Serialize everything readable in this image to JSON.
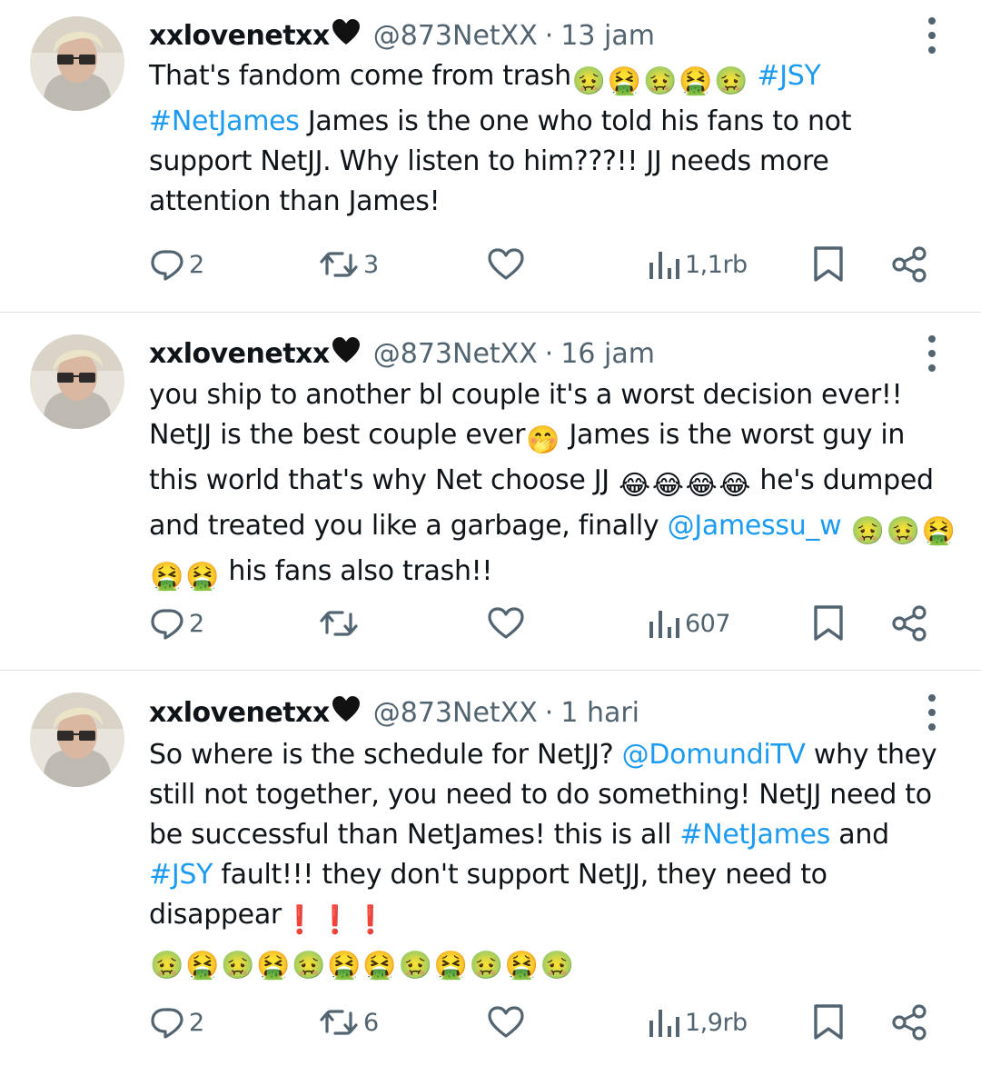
{
  "tweets": [
    {
      "name": "xxlovenetxx",
      "name_emoji": "🖤",
      "handle": "@873NetXX",
      "separator": "·",
      "time": "13 jam",
      "body": [
        {
          "t": "text",
          "v": "That's fandom come from trash"
        },
        {
          "t": "emoji",
          "v": "🤢"
        },
        {
          "t": "emoji",
          "v": "🤮"
        },
        {
          "t": "emoji",
          "v": "🤢"
        },
        {
          "t": "emoji",
          "v": "🤮"
        },
        {
          "t": "emoji",
          "v": "🤢"
        },
        {
          "t": "text",
          "v": " "
        },
        {
          "t": "link",
          "v": "#JSY"
        },
        {
          "t": "br"
        },
        {
          "t": "link",
          "v": "#NetJames"
        },
        {
          "t": "text",
          "v": " James is the one who told his fans to not"
        },
        {
          "t": "br"
        },
        {
          "t": "text",
          "v": "support NetJJ. Why listen to him???!! JJ needs more"
        },
        {
          "t": "br"
        },
        {
          "t": "text",
          "v": "attention than James!"
        }
      ],
      "replies": "2",
      "retweets": "3",
      "likes": "",
      "views": "1,1rb"
    },
    {
      "name": "xxlovenetxx",
      "name_emoji": "🖤",
      "handle": "@873NetXX",
      "separator": "·",
      "time": "16 jam",
      "body": [
        {
          "t": "text",
          "v": "you ship to another bl couple it's a worst decision ever!!"
        },
        {
          "t": "br"
        },
        {
          "t": "text",
          "v": "NetJJ is the best couple ever"
        },
        {
          "t": "emoji",
          "v": "🤭"
        },
        {
          "t": "text",
          "v": " James is the worst guy in"
        },
        {
          "t": "br"
        },
        {
          "t": "text",
          "v": "this world that's why Net choose JJ "
        },
        {
          "t": "emoji",
          "v": "😂"
        },
        {
          "t": "emoji",
          "v": "😂"
        },
        {
          "t": "emoji",
          "v": "😂"
        },
        {
          "t": "emoji",
          "v": "😂"
        },
        {
          "t": "text",
          "v": " he's dumped"
        },
        {
          "t": "br"
        },
        {
          "t": "text",
          "v": "and treated you like a garbage, finally "
        },
        {
          "t": "link",
          "v": "@Jamessu_w"
        },
        {
          "t": "text",
          "v": " "
        },
        {
          "t": "emoji",
          "v": "🤢"
        },
        {
          "t": "emoji",
          "v": "🤢"
        },
        {
          "t": "emoji",
          "v": "🤮"
        },
        {
          "t": "br"
        },
        {
          "t": "emoji",
          "v": "🤮"
        },
        {
          "t": "emoji",
          "v": "🤮"
        },
        {
          "t": "text",
          "v": " his fans also trash!!"
        }
      ],
      "replies": "2",
      "retweets": "",
      "likes": "",
      "views": "607"
    },
    {
      "name": "xxlovenetxx",
      "name_emoji": "🖤",
      "handle": "@873NetXX",
      "separator": "·",
      "time": "1 hari",
      "body": [
        {
          "t": "text",
          "v": "So where is the schedule for NetJJ? "
        },
        {
          "t": "link",
          "v": "@DomundiTV"
        },
        {
          "t": "text",
          "v": " why they"
        },
        {
          "t": "br"
        },
        {
          "t": "text",
          "v": "still not together, you need to do something! NetJJ need to"
        },
        {
          "t": "br"
        },
        {
          "t": "text",
          "v": "be successful than NetJames! this is all "
        },
        {
          "t": "link",
          "v": "#NetJames"
        },
        {
          "t": "text",
          "v": " and"
        },
        {
          "t": "br"
        },
        {
          "t": "link",
          "v": "#JSY"
        },
        {
          "t": "text",
          "v": " fault!!! they don't support NetJJ, they need to"
        },
        {
          "t": "br"
        },
        {
          "t": "text",
          "v": "disappear"
        },
        {
          "t": "emoji",
          "v": "❗"
        },
        {
          "t": "emoji",
          "v": "❗"
        },
        {
          "t": "emoji",
          "v": "❗"
        },
        {
          "t": "br"
        },
        {
          "t": "emoji",
          "v": "🤢"
        },
        {
          "t": "emoji",
          "v": "🤮"
        },
        {
          "t": "emoji",
          "v": "🤢"
        },
        {
          "t": "emoji",
          "v": "🤮"
        },
        {
          "t": "emoji",
          "v": "🤢"
        },
        {
          "t": "emoji",
          "v": "🤮"
        },
        {
          "t": "emoji",
          "v": "🤮"
        },
        {
          "t": "emoji",
          "v": "🤢"
        },
        {
          "t": "emoji",
          "v": "🤮"
        },
        {
          "t": "emoji",
          "v": "🤢"
        },
        {
          "t": "emoji",
          "v": "🤮"
        },
        {
          "t": "emoji",
          "v": "🤢"
        }
      ],
      "replies": "2",
      "retweets": "6",
      "likes": "",
      "views": "1,9rb"
    }
  ],
  "icons": {
    "reply": "reply-icon",
    "retweet": "retweet-icon",
    "like": "heart-icon",
    "views": "views-icon",
    "bookmark": "bookmark-icon",
    "share": "share-icon",
    "more": "more-icon"
  },
  "colors": {
    "link": "#1d9bf0",
    "secondary": "#536471",
    "text": "#0f1419",
    "divider": "#dfe3e6"
  }
}
